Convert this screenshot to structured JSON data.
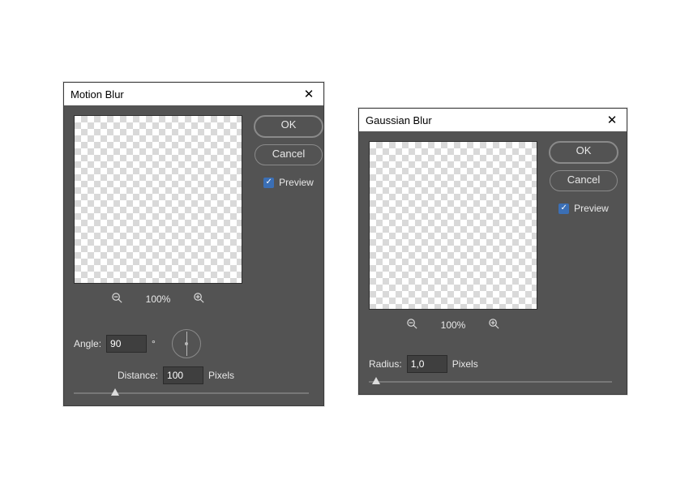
{
  "motion": {
    "title": "Motion Blur",
    "ok": "OK",
    "cancel": "Cancel",
    "preview_label": "Preview",
    "preview_checked": "✓",
    "zoom": "100%",
    "angle_label": "Angle:",
    "angle_value": "90",
    "angle_unit": "°",
    "distance_label": "Distance:",
    "distance_value": "100",
    "distance_unit": "Pixels"
  },
  "gaussian": {
    "title": "Gaussian Blur",
    "ok": "OK",
    "cancel": "Cancel",
    "preview_label": "Preview",
    "preview_checked": "✓",
    "zoom": "100%",
    "radius_label": "Radius:",
    "radius_value": "1,0",
    "radius_unit": "Pixels"
  }
}
